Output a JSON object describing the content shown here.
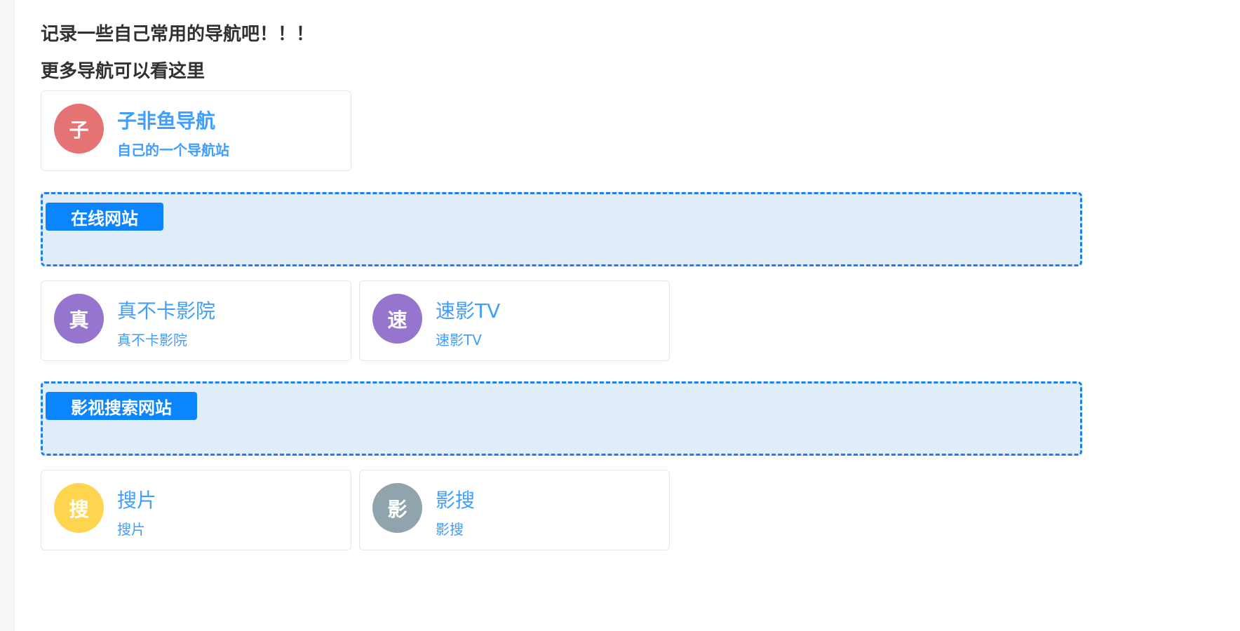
{
  "headings": {
    "intro": "记录一些自己常用的导航吧！！！",
    "more": "更多导航可以看这里"
  },
  "featured": {
    "avatar": "子",
    "avatar_color": "#e57373",
    "title": "子非鱼导航",
    "desc": "自己的一个导航站"
  },
  "sections": [
    {
      "label": "在线网站",
      "cards": [
        {
          "avatar": "真",
          "avatar_color": "#9575cd",
          "title": "真不卡影院",
          "desc": "真不卡影院"
        },
        {
          "avatar": "速",
          "avatar_color": "#9575cd",
          "title": "速影TV",
          "desc": "速影TV"
        }
      ]
    },
    {
      "label": "影视搜索网站",
      "cards": [
        {
          "avatar": "搜",
          "avatar_color": "#ffd54f",
          "title": "搜片",
          "desc": "搜片"
        },
        {
          "avatar": "影",
          "avatar_color": "#90a4ae",
          "title": "影搜",
          "desc": "影搜"
        }
      ]
    }
  ],
  "colors": {
    "link": "#409eff",
    "section_bg": "#e1edf9",
    "section_border": "#1a7ff0",
    "tag_bg": "#0a84ff"
  }
}
